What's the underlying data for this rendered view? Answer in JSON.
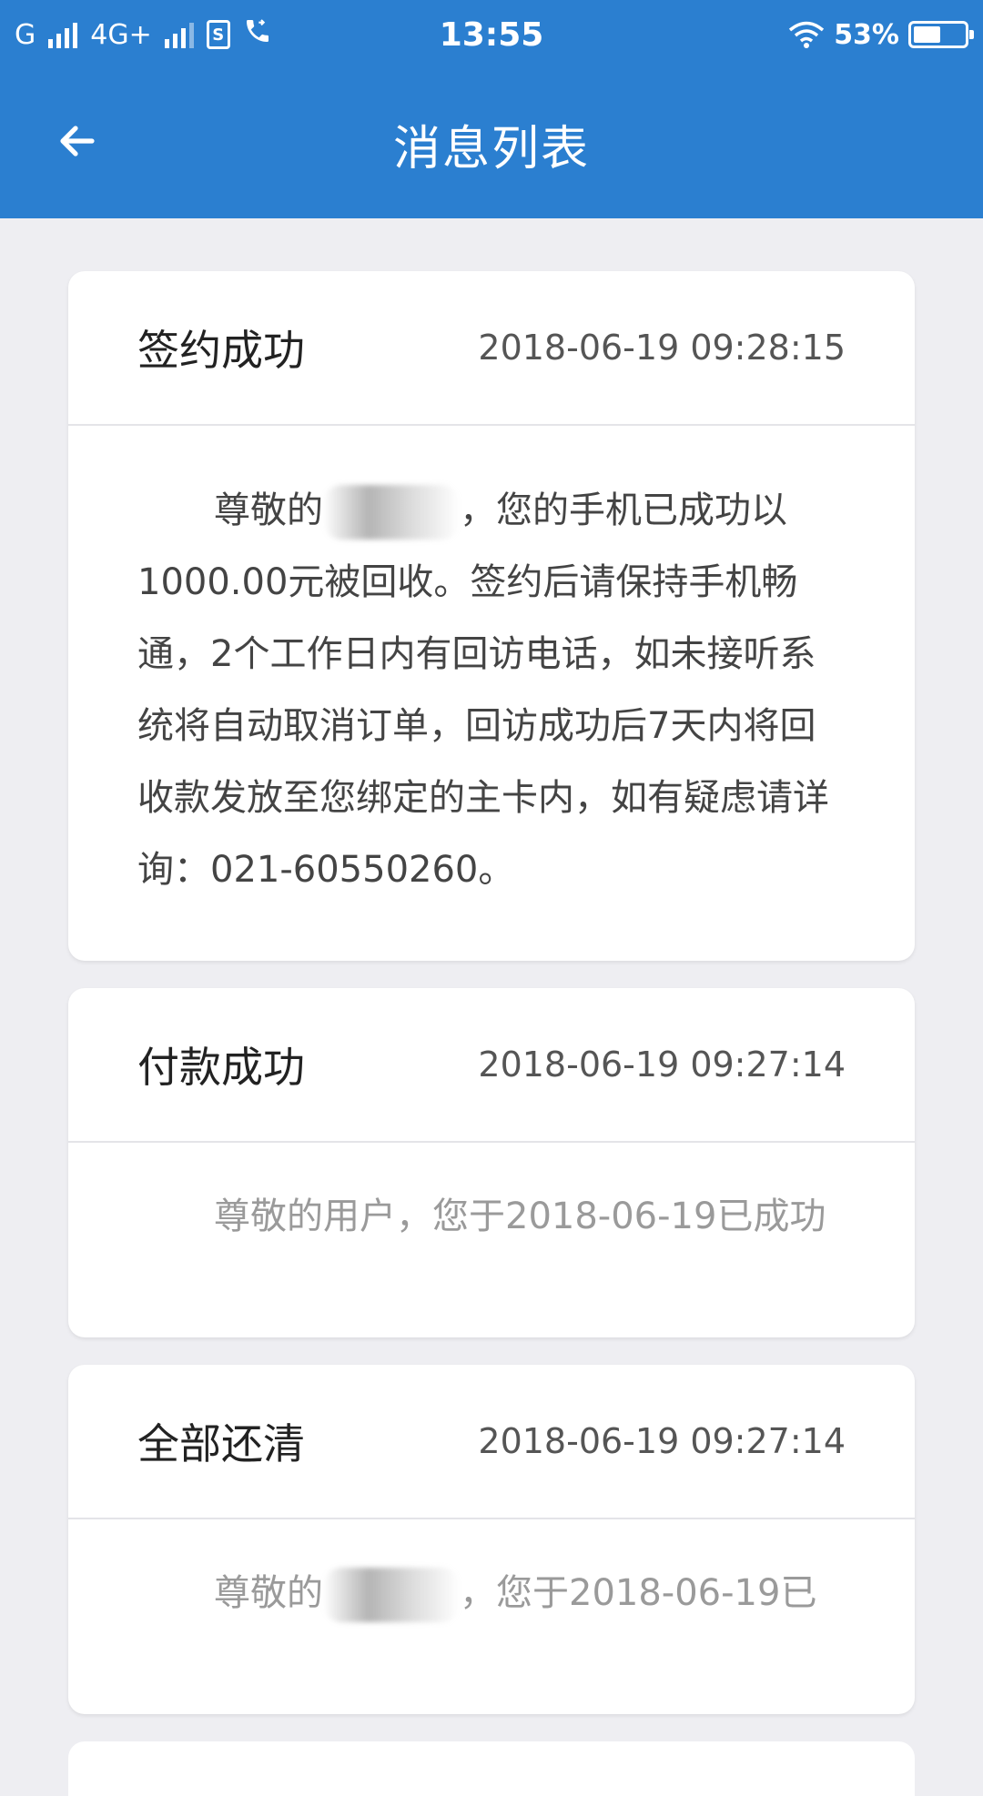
{
  "status_bar": {
    "carrier1": "G",
    "carrier2": "4G+",
    "sim_label": "S",
    "time": "13:55",
    "battery": "53%",
    "battery_level": 0.53
  },
  "header": {
    "title": "消息列表",
    "back_icon": "arrow-left-icon"
  },
  "messages": [
    {
      "title": "签约成功",
      "time": "2018-06-19 09:28:15",
      "body_prefix": "尊敬的",
      "body_suffix": "，您的手机已成功以1000.00元被回收。签约后请保持手机畅通，2个工作日内有回访电话，如未接听系统将自动取消订单，回访成功后7天内将回收款发放至您绑定的主卡内，如有疑虑请详询：021-60550260。"
    },
    {
      "title": "付款成功",
      "time": "2018-06-19 09:27:14",
      "body": "尊敬的用户，您于2018-06-19已成功"
    },
    {
      "title": "全部还清",
      "time": "2018-06-19 09:27:14",
      "body_prefix": "尊敬的",
      "body_suffix": "，您于2018-06-19已"
    }
  ],
  "colors": {
    "primary": "#2b7fd0",
    "background": "#eeeef2",
    "card": "#ffffff"
  }
}
